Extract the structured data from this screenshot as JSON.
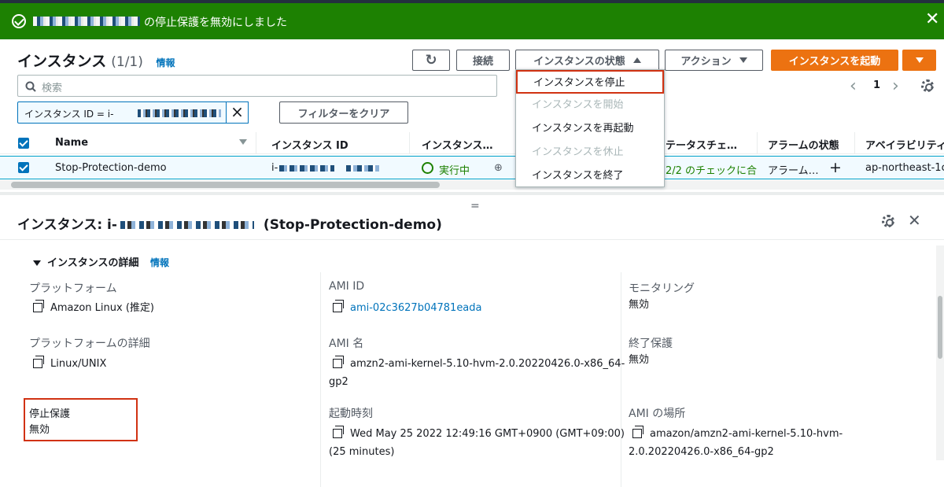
{
  "flash": {
    "message": "の停止保護を無効にしました",
    "close": "✕"
  },
  "header": {
    "title": "インスタンス",
    "count": "(1/1)",
    "info": "情報",
    "buttons": {
      "refresh": "↻",
      "connect": "接続",
      "instance_state": "インスタンスの状態",
      "actions": "アクション",
      "launch": "インスタンスを起動"
    }
  },
  "search": {
    "placeholder": "検索"
  },
  "filter": {
    "token": "インスタンス ID = i-",
    "clear": "フィルターをクリア"
  },
  "pagination": {
    "prev": "‹",
    "page": "1",
    "next": "›"
  },
  "dropdown": {
    "items": [
      {
        "label": "インスタンスを停止"
      },
      {
        "label": "インスタンスを開始"
      },
      {
        "label": "インスタンスを再起動"
      },
      {
        "label": "インスタンスを休止"
      },
      {
        "label": "インスタンスを終了"
      }
    ]
  },
  "table": {
    "columns": [
      "Name",
      "インスタンス ID",
      "インスタンス…",
      "ステータスチェ…",
      "アラームの状態",
      "アベイラビリティ"
    ],
    "row": {
      "name": "Stop-Protection-demo",
      "id": "i-",
      "state": "実行中",
      "status_check": "2/2 のチェックに合",
      "alarm": "アラーム…",
      "alarm_add": "+",
      "az": "ap-northeast-1c"
    }
  },
  "details": {
    "title_prefix": "インスタンス: i-",
    "title_name": "(Stop-Protection-demo)",
    "close": "✕",
    "section": "インスタンスの詳細",
    "section_info": "情報",
    "fields": {
      "platform_label": "プラットフォーム",
      "platform_value": "Amazon Linux (推定)",
      "ami_id_label": "AMI ID",
      "ami_id_value": "ami-02c3627b04781eada",
      "monitoring_label": "モニタリング",
      "monitoring_value": "無効",
      "platform_detail_label": "プラットフォームの詳細",
      "platform_detail_value": "Linux/UNIX",
      "ami_name_label": "AMI 名",
      "ami_name_value_1": "amzn2-ami-kernel-5.10-hvm-2.0.20220426.0-x86_64-",
      "ami_name_value_2": "gp2",
      "termination_label": "終了保護",
      "termination_value": "無効",
      "stop_protection_label": "停止保護",
      "stop_protection_value": "無効",
      "launch_time_label": "起動時刻",
      "launch_time_value_1": "Wed May 25 2022 12:49:16 GMT+0900 (GMT+09:00)",
      "launch_time_value_2": "(25 minutes)",
      "ami_location_label": "AMI の場所",
      "ami_location_value_1": "amazon/amzn2-ami-kernel-5.10-hvm-",
      "ami_location_value_2": "2.0.20220426.0-x86_64-gp2"
    }
  }
}
